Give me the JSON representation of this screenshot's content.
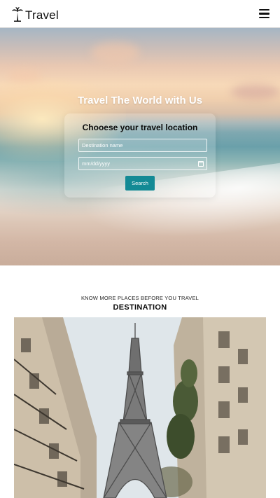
{
  "nav": {
    "brand": "Travel",
    "brand_icon": "palm-tree-icon",
    "menu_icon": "hamburger-menu-icon"
  },
  "hero": {
    "title": "Travel The World with Us",
    "form": {
      "title": "Chooese your travel location",
      "destination_placeholder": "Destination name",
      "date_placeholder": "mm/dd/yyyy",
      "date_icon": "calendar-icon",
      "search_label": "Search"
    }
  },
  "destination": {
    "kicker": "KNOW MORE PLACES BEFORE YOU TRAVEL",
    "title": "DESTINATION",
    "photo_subject": "Eiffel Tower"
  },
  "colors": {
    "accent": "#138a95",
    "navbar_bg": "#ffffff",
    "text": "#111111"
  }
}
